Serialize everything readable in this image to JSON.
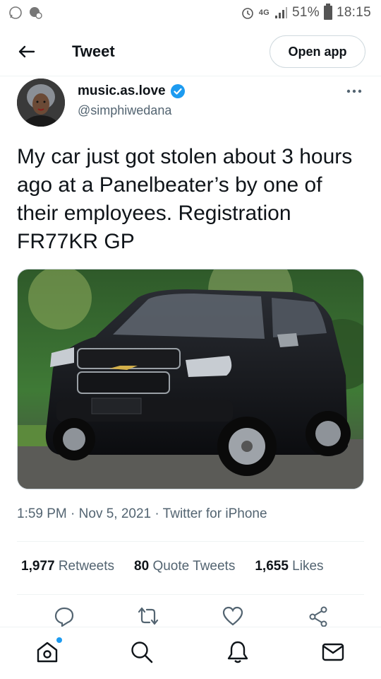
{
  "status_bar": {
    "battery": "51%",
    "time": "18:15",
    "network": "4G"
  },
  "header": {
    "title": "Tweet",
    "open_app_label": "Open app"
  },
  "author": {
    "name": "music.as.love",
    "handle": "@simphiwedana",
    "verified": true
  },
  "tweet": {
    "text": "My car just got stolen about 3 hours ago at a Panelbeater’s by one of their employees. Registration FR77KR GP",
    "time": "1:59 PM",
    "date": "Nov 5, 2021",
    "source": "Twitter for iPhone"
  },
  "stats": {
    "retweets_count": "1,977",
    "retweets_label": "Retweets",
    "quotes_count": "80",
    "quotes_label": "Quote Tweets",
    "likes_count": "1,655",
    "likes_label": "Likes"
  },
  "icons": {
    "back": "arrow-left-icon",
    "more": "more-icon",
    "reply": "reply-icon",
    "retweet": "retweet-icon",
    "like": "heart-icon",
    "share": "share-icon",
    "home": "home-icon",
    "search": "search-icon",
    "notifications": "bell-icon",
    "messages": "mail-icon"
  },
  "colors": {
    "accent": "#1d9bf0",
    "text": "#0f1419",
    "secondary": "#536471"
  }
}
